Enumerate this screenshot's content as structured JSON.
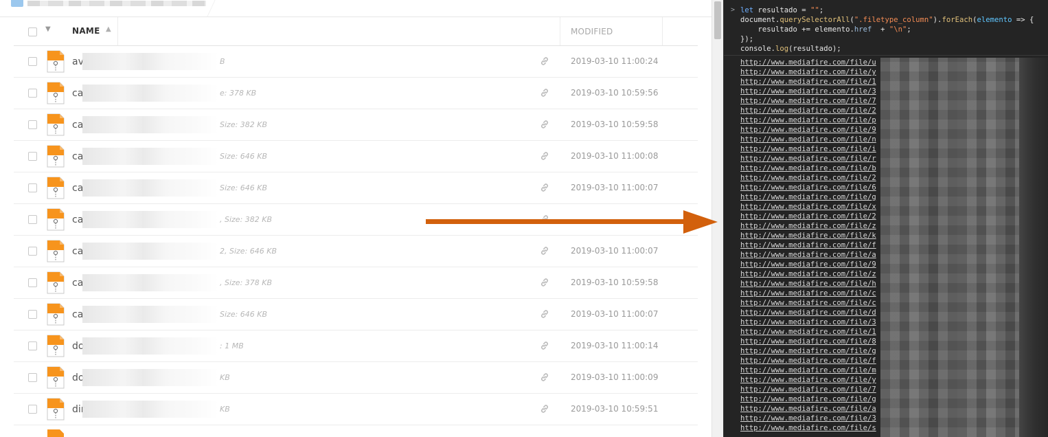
{
  "file_list": {
    "header": {
      "name_label": "NAME",
      "modified_label": "MODIFIED"
    },
    "rows": [
      {
        "name": "av",
        "size": "B",
        "modified": "2019-03-10 11:00:24"
      },
      {
        "name": "ca",
        "size": "e: 378 KB",
        "modified": "2019-03-10 10:59:56"
      },
      {
        "name": "ca",
        "size": "Size: 382 KB",
        "modified": "2019-03-10 10:59:58"
      },
      {
        "name": "ca",
        "size": "Size: 646 KB",
        "modified": "2019-03-10 11:00:08"
      },
      {
        "name": "ca",
        "size": "Size: 646 KB",
        "modified": "2019-03-10 11:00:07"
      },
      {
        "name": "ca",
        "size": ", Size: 382 KB",
        "modified": ""
      },
      {
        "name": "ca",
        "size": "2, Size: 646 KB",
        "modified": "2019-03-10 11:00:07"
      },
      {
        "name": "ca",
        "size": ", Size: 378 KB",
        "modified": "2019-03-10 10:59:58"
      },
      {
        "name": "ca",
        "size": "Size: 646 KB",
        "modified": "2019-03-10 11:00:07"
      },
      {
        "name": "do",
        "size": ": 1 MB",
        "modified": "2019-03-10 11:00:14"
      },
      {
        "name": "do",
        "size": "KB",
        "modified": "2019-03-10 11:00:09"
      },
      {
        "name": "dir",
        "size": "KB",
        "modified": "2019-03-10 10:59:51"
      }
    ]
  },
  "console": {
    "prompt_symbol": ">",
    "code": {
      "l1_kw": "let",
      "l1_var": " resultado = ",
      "l1_str": "\"\"",
      "l1_end": ";",
      "l2_obj": "document.",
      "l2_fn": "querySelectorAll",
      "l2_open": "(",
      "l2_str": "\".filetype_column\"",
      "l2_mid": ").",
      "l2_each": "forEach",
      "l2_paren": "(",
      "l2_param": "elemento",
      "l2_arrow": " => {",
      "l3_a": "    resultado += elemento.",
      "l3_prop": "href",
      "l3_b": "  + ",
      "l3_str": "\"\\n\"",
      "l3_end": ";",
      "l4": "});",
      "l5_a": "console.",
      "l5_fn": "log",
      "l5_b": "(resultado);"
    },
    "output_lines": [
      "http://www.mediafire.com/file/u",
      "http://www.mediafire.com/file/y",
      "http://www.mediafire.com/file/1",
      "http://www.mediafire.com/file/3",
      "http://www.mediafire.com/file/7",
      "http://www.mediafire.com/file/2",
      "http://www.mediafire.com/file/p",
      "http://www.mediafire.com/file/9",
      "http://www.mediafire.com/file/n",
      "http://www.mediafire.com/file/i",
      "http://www.mediafire.com/file/r",
      "http://www.mediafire.com/file/b",
      "http://www.mediafire.com/file/2",
      "http://www.mediafire.com/file/6",
      "http://www.mediafire.com/file/g",
      "http://www.mediafire.com/file/x",
      "http://www.mediafire.com/file/2",
      "http://www.mediafire.com/file/z",
      "http://www.mediafire.com/file/k",
      "http://www.mediafire.com/file/f",
      "http://www.mediafire.com/file/a",
      "http://www.mediafire.com/file/9",
      "http://www.mediafire.com/file/z",
      "http://www.mediafire.com/file/h",
      "http://www.mediafire.com/file/c",
      "http://www.mediafire.com/file/c",
      "http://www.mediafire.com/file/d",
      "http://www.mediafire.com/file/3",
      "http://www.mediafire.com/file/1",
      "http://www.mediafire.com/file/8",
      "http://www.mediafire.com/file/g",
      "http://www.mediafire.com/file/f",
      "http://www.mediafire.com/file/m",
      "http://www.mediafire.com/file/y",
      "http://www.mediafire.com/file/7",
      "http://www.mediafire.com/file/g",
      "http://www.mediafire.com/file/a",
      "http://www.mediafire.com/file/3",
      "http://www.mediafire.com/file/s"
    ]
  },
  "colors": {
    "arrow": "#d2600c",
    "zip_icon": "#f7941d",
    "console_bg": "#242424"
  },
  "icons": {
    "file": "zip-file-icon",
    "share": "link-icon",
    "folder": "folder-icon"
  }
}
